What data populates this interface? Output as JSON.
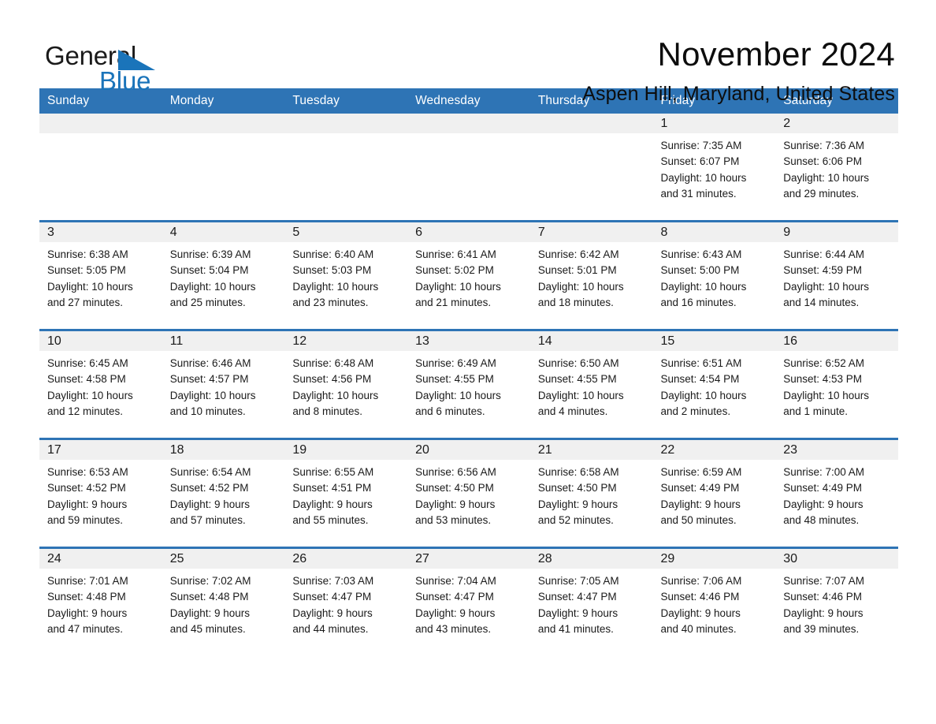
{
  "brand": {
    "name_part1": "General",
    "name_part2": "Blue",
    "accent_color": "#1a74ba"
  },
  "header": {
    "month_title": "November 2024",
    "location": "Aspen Hill, Maryland, United States",
    "header_bg_color": "#2e74b5",
    "daynum_bg_color": "#f0f0f0"
  },
  "weekday_headers": [
    "Sunday",
    "Monday",
    "Tuesday",
    "Wednesday",
    "Thursday",
    "Friday",
    "Saturday"
  ],
  "weeks": [
    [
      {
        "day": "",
        "empty": true,
        "sunrise": "",
        "sunset": "",
        "daylight_line1": "",
        "daylight_line2": ""
      },
      {
        "day": "",
        "empty": true,
        "sunrise": "",
        "sunset": "",
        "daylight_line1": "",
        "daylight_line2": ""
      },
      {
        "day": "",
        "empty": true,
        "sunrise": "",
        "sunset": "",
        "daylight_line1": "",
        "daylight_line2": ""
      },
      {
        "day": "",
        "empty": true,
        "sunrise": "",
        "sunset": "",
        "daylight_line1": "",
        "daylight_line2": ""
      },
      {
        "day": "",
        "empty": true,
        "sunrise": "",
        "sunset": "",
        "daylight_line1": "",
        "daylight_line2": ""
      },
      {
        "day": "1",
        "empty": false,
        "sunrise": "Sunrise: 7:35 AM",
        "sunset": "Sunset: 6:07 PM",
        "daylight_line1": "Daylight: 10 hours",
        "daylight_line2": "and 31 minutes."
      },
      {
        "day": "2",
        "empty": false,
        "sunrise": "Sunrise: 7:36 AM",
        "sunset": "Sunset: 6:06 PM",
        "daylight_line1": "Daylight: 10 hours",
        "daylight_line2": "and 29 minutes."
      }
    ],
    [
      {
        "day": "3",
        "empty": false,
        "sunrise": "Sunrise: 6:38 AM",
        "sunset": "Sunset: 5:05 PM",
        "daylight_line1": "Daylight: 10 hours",
        "daylight_line2": "and 27 minutes."
      },
      {
        "day": "4",
        "empty": false,
        "sunrise": "Sunrise: 6:39 AM",
        "sunset": "Sunset: 5:04 PM",
        "daylight_line1": "Daylight: 10 hours",
        "daylight_line2": "and 25 minutes."
      },
      {
        "day": "5",
        "empty": false,
        "sunrise": "Sunrise: 6:40 AM",
        "sunset": "Sunset: 5:03 PM",
        "daylight_line1": "Daylight: 10 hours",
        "daylight_line2": "and 23 minutes."
      },
      {
        "day": "6",
        "empty": false,
        "sunrise": "Sunrise: 6:41 AM",
        "sunset": "Sunset: 5:02 PM",
        "daylight_line1": "Daylight: 10 hours",
        "daylight_line2": "and 21 minutes."
      },
      {
        "day": "7",
        "empty": false,
        "sunrise": "Sunrise: 6:42 AM",
        "sunset": "Sunset: 5:01 PM",
        "daylight_line1": "Daylight: 10 hours",
        "daylight_line2": "and 18 minutes."
      },
      {
        "day": "8",
        "empty": false,
        "sunrise": "Sunrise: 6:43 AM",
        "sunset": "Sunset: 5:00 PM",
        "daylight_line1": "Daylight: 10 hours",
        "daylight_line2": "and 16 minutes."
      },
      {
        "day": "9",
        "empty": false,
        "sunrise": "Sunrise: 6:44 AM",
        "sunset": "Sunset: 4:59 PM",
        "daylight_line1": "Daylight: 10 hours",
        "daylight_line2": "and 14 minutes."
      }
    ],
    [
      {
        "day": "10",
        "empty": false,
        "sunrise": "Sunrise: 6:45 AM",
        "sunset": "Sunset: 4:58 PM",
        "daylight_line1": "Daylight: 10 hours",
        "daylight_line2": "and 12 minutes."
      },
      {
        "day": "11",
        "empty": false,
        "sunrise": "Sunrise: 6:46 AM",
        "sunset": "Sunset: 4:57 PM",
        "daylight_line1": "Daylight: 10 hours",
        "daylight_line2": "and 10 minutes."
      },
      {
        "day": "12",
        "empty": false,
        "sunrise": "Sunrise: 6:48 AM",
        "sunset": "Sunset: 4:56 PM",
        "daylight_line1": "Daylight: 10 hours",
        "daylight_line2": "and 8 minutes."
      },
      {
        "day": "13",
        "empty": false,
        "sunrise": "Sunrise: 6:49 AM",
        "sunset": "Sunset: 4:55 PM",
        "daylight_line1": "Daylight: 10 hours",
        "daylight_line2": "and 6 minutes."
      },
      {
        "day": "14",
        "empty": false,
        "sunrise": "Sunrise: 6:50 AM",
        "sunset": "Sunset: 4:55 PM",
        "daylight_line1": "Daylight: 10 hours",
        "daylight_line2": "and 4 minutes."
      },
      {
        "day": "15",
        "empty": false,
        "sunrise": "Sunrise: 6:51 AM",
        "sunset": "Sunset: 4:54 PM",
        "daylight_line1": "Daylight: 10 hours",
        "daylight_line2": "and 2 minutes."
      },
      {
        "day": "16",
        "empty": false,
        "sunrise": "Sunrise: 6:52 AM",
        "sunset": "Sunset: 4:53 PM",
        "daylight_line1": "Daylight: 10 hours",
        "daylight_line2": "and 1 minute."
      }
    ],
    [
      {
        "day": "17",
        "empty": false,
        "sunrise": "Sunrise: 6:53 AM",
        "sunset": "Sunset: 4:52 PM",
        "daylight_line1": "Daylight: 9 hours",
        "daylight_line2": "and 59 minutes."
      },
      {
        "day": "18",
        "empty": false,
        "sunrise": "Sunrise: 6:54 AM",
        "sunset": "Sunset: 4:52 PM",
        "daylight_line1": "Daylight: 9 hours",
        "daylight_line2": "and 57 minutes."
      },
      {
        "day": "19",
        "empty": false,
        "sunrise": "Sunrise: 6:55 AM",
        "sunset": "Sunset: 4:51 PM",
        "daylight_line1": "Daylight: 9 hours",
        "daylight_line2": "and 55 minutes."
      },
      {
        "day": "20",
        "empty": false,
        "sunrise": "Sunrise: 6:56 AM",
        "sunset": "Sunset: 4:50 PM",
        "daylight_line1": "Daylight: 9 hours",
        "daylight_line2": "and 53 minutes."
      },
      {
        "day": "21",
        "empty": false,
        "sunrise": "Sunrise: 6:58 AM",
        "sunset": "Sunset: 4:50 PM",
        "daylight_line1": "Daylight: 9 hours",
        "daylight_line2": "and 52 minutes."
      },
      {
        "day": "22",
        "empty": false,
        "sunrise": "Sunrise: 6:59 AM",
        "sunset": "Sunset: 4:49 PM",
        "daylight_line1": "Daylight: 9 hours",
        "daylight_line2": "and 50 minutes."
      },
      {
        "day": "23",
        "empty": false,
        "sunrise": "Sunrise: 7:00 AM",
        "sunset": "Sunset: 4:49 PM",
        "daylight_line1": "Daylight: 9 hours",
        "daylight_line2": "and 48 minutes."
      }
    ],
    [
      {
        "day": "24",
        "empty": false,
        "sunrise": "Sunrise: 7:01 AM",
        "sunset": "Sunset: 4:48 PM",
        "daylight_line1": "Daylight: 9 hours",
        "daylight_line2": "and 47 minutes."
      },
      {
        "day": "25",
        "empty": false,
        "sunrise": "Sunrise: 7:02 AM",
        "sunset": "Sunset: 4:48 PM",
        "daylight_line1": "Daylight: 9 hours",
        "daylight_line2": "and 45 minutes."
      },
      {
        "day": "26",
        "empty": false,
        "sunrise": "Sunrise: 7:03 AM",
        "sunset": "Sunset: 4:47 PM",
        "daylight_line1": "Daylight: 9 hours",
        "daylight_line2": "and 44 minutes."
      },
      {
        "day": "27",
        "empty": false,
        "sunrise": "Sunrise: 7:04 AM",
        "sunset": "Sunset: 4:47 PM",
        "daylight_line1": "Daylight: 9 hours",
        "daylight_line2": "and 43 minutes."
      },
      {
        "day": "28",
        "empty": false,
        "sunrise": "Sunrise: 7:05 AM",
        "sunset": "Sunset: 4:47 PM",
        "daylight_line1": "Daylight: 9 hours",
        "daylight_line2": "and 41 minutes."
      },
      {
        "day": "29",
        "empty": false,
        "sunrise": "Sunrise: 7:06 AM",
        "sunset": "Sunset: 4:46 PM",
        "daylight_line1": "Daylight: 9 hours",
        "daylight_line2": "and 40 minutes."
      },
      {
        "day": "30",
        "empty": false,
        "sunrise": "Sunrise: 7:07 AM",
        "sunset": "Sunset: 4:46 PM",
        "daylight_line1": "Daylight: 9 hours",
        "daylight_line2": "and 39 minutes."
      }
    ]
  ]
}
